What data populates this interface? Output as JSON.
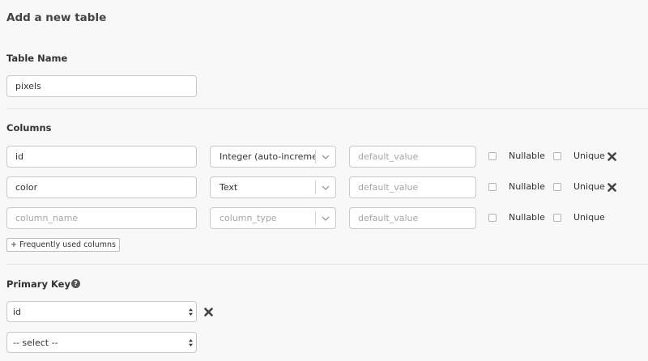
{
  "page": {
    "title": "Add a new table"
  },
  "table_name": {
    "label": "Table Name",
    "value": "pixels"
  },
  "columns": {
    "label": "Columns",
    "nullable_label": "Nullable",
    "unique_label": "Unique",
    "default_placeholder": "default_value",
    "rows": [
      {
        "name": "id",
        "name_placeholder": "",
        "type": "Integer (auto-increment)",
        "type_is_placeholder": false,
        "removable": true
      },
      {
        "name": "color",
        "name_placeholder": "",
        "type": "Text",
        "type_is_placeholder": false,
        "removable": true
      },
      {
        "name": "",
        "name_placeholder": "column_name",
        "type": "column_type",
        "type_is_placeholder": true,
        "removable": false
      }
    ],
    "frequently_used_label": "+ Frequently used columns"
  },
  "primary_key": {
    "label": "Primary Key",
    "help_icon": "question-circle-icon",
    "selected": "id",
    "next_placeholder": "-- select --"
  }
}
